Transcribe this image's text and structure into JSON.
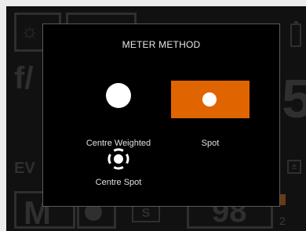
{
  "dialog": {
    "title": "METER METHOD",
    "options": [
      {
        "label": "Centre Weighted",
        "icon": "centre-weighted-icon",
        "selected": false
      },
      {
        "label": "Spot",
        "icon": "spot-icon",
        "selected": true
      },
      {
        "label": "Centre Spot",
        "icon": "centre-spot-icon",
        "selected": false
      }
    ]
  },
  "background_hud": {
    "aperture_prefix": "f/",
    "shutter_value": "5",
    "ev_label": "EV",
    "mode_label": "M",
    "shots_remaining": "98",
    "drive_label": "S",
    "frame_suffix": "2"
  },
  "colors": {
    "accent": "#e06400",
    "modal_bg": "#000000",
    "screen_bg": "#111111",
    "page_bg": "#ececec",
    "dim_hud": "#2f2f2f"
  }
}
